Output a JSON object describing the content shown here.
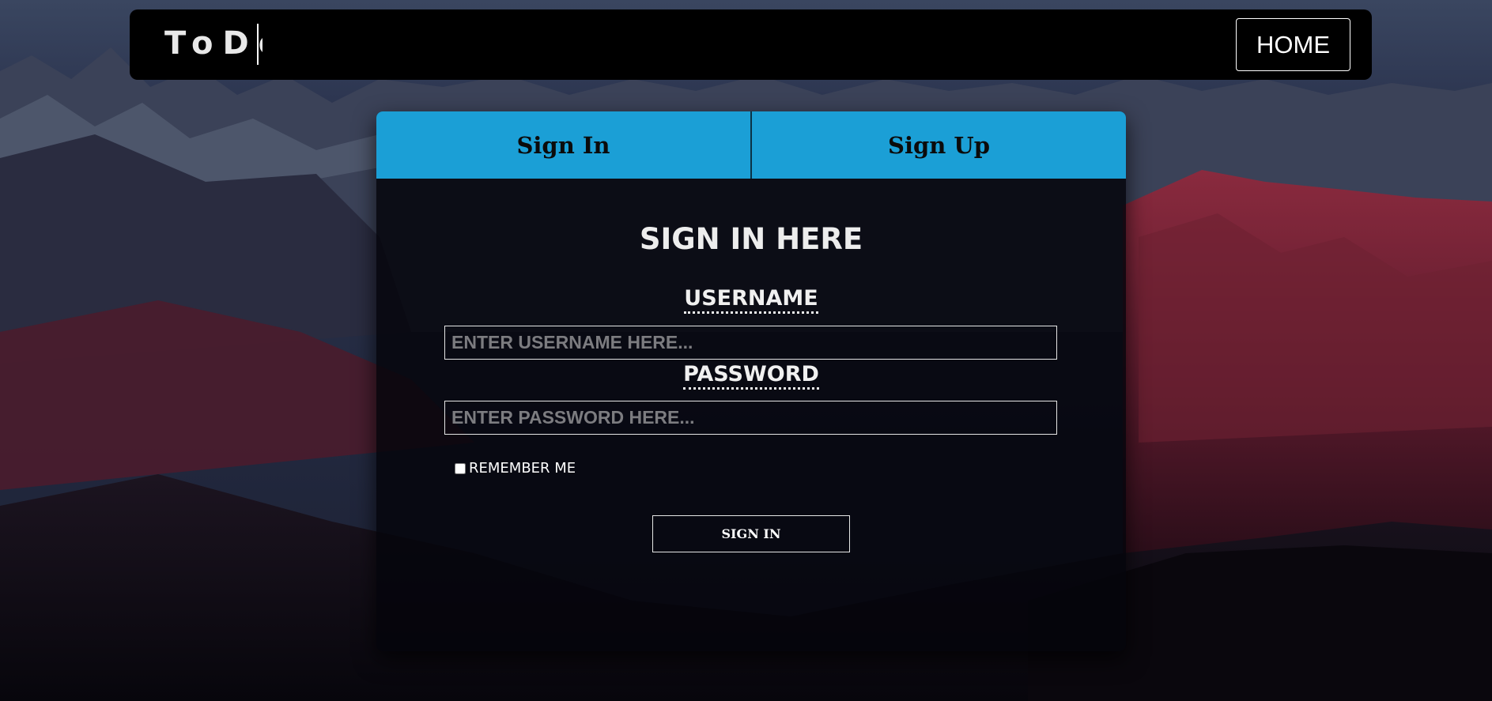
{
  "navbar": {
    "brand": "ToDo",
    "home_label": "HOME"
  },
  "tabs": [
    {
      "label": "Sign In"
    },
    {
      "label": "Sign Up"
    }
  ],
  "form": {
    "heading": "SIGN IN HERE",
    "username_label": "USERNAME",
    "username_placeholder": "ENTER USERNAME HERE...",
    "password_label": "PASSWORD",
    "password_placeholder": "ENTER PASSWORD HERE...",
    "remember_label": "REMEMBER ME",
    "submit_label": "SIGN IN"
  },
  "colors": {
    "tab_bar": "#1b9fd6",
    "navbar": "#000000",
    "card": "#05050c"
  }
}
